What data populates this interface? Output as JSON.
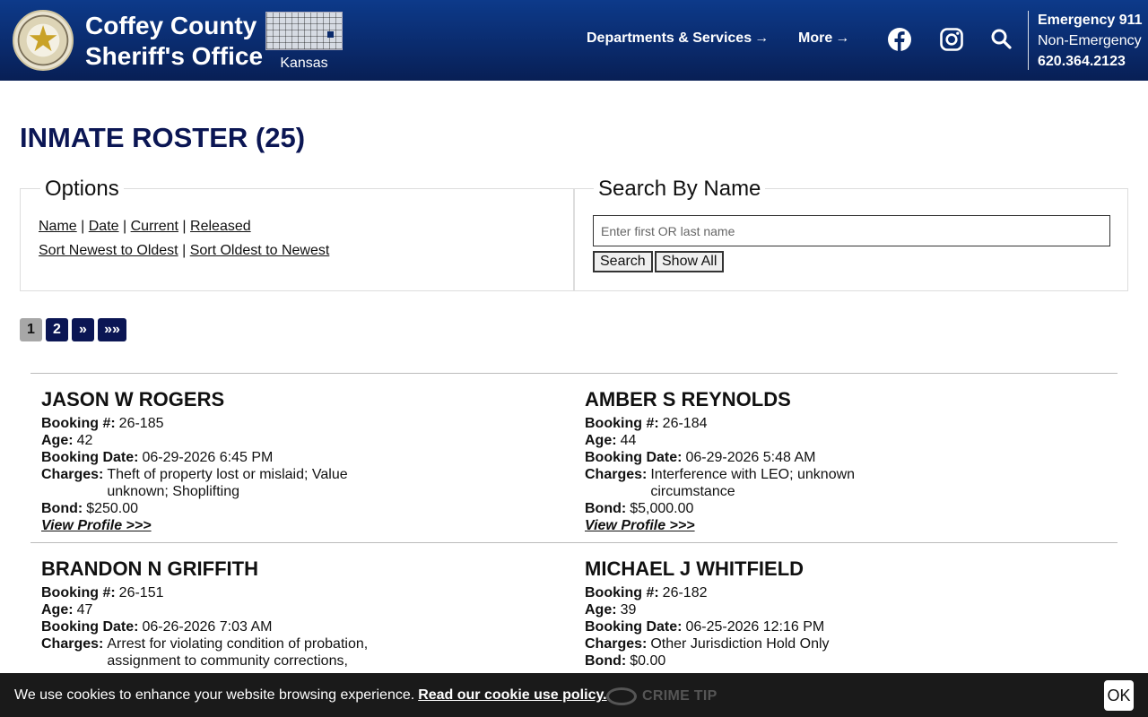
{
  "header": {
    "brand_line1": "Coffey County",
    "brand_line2": "Sheriff's Office",
    "state_label": "Kansas",
    "nav": [
      {
        "label": "Departments & Services"
      },
      {
        "label": "More"
      }
    ],
    "contact": {
      "emergency": "Emergency 911",
      "non_emergency_label": "Non-Emergency",
      "phone": "620.364.2123"
    }
  },
  "page": {
    "title": "INMATE ROSTER (25)"
  },
  "options": {
    "title": "Options",
    "filters": [
      "Name",
      "Date",
      "Current",
      "Released"
    ],
    "sort": [
      "Sort Newest to Oldest",
      "Sort Oldest to Newest"
    ],
    "separator": "|"
  },
  "search": {
    "title": "Search By Name",
    "placeholder": "Enter first OR last name",
    "search_button": "Search",
    "show_all_button": "Show All"
  },
  "pagination": {
    "pages": [
      "1",
      "2"
    ],
    "next": "»",
    "last": "»»",
    "current": "1"
  },
  "labels": {
    "booking": "Booking #:",
    "age": "Age:",
    "booking_date": "Booking Date:",
    "charges": "Charges:",
    "bond": "Bond:",
    "view_profile": "View Profile >>>"
  },
  "inmates": [
    {
      "name": "JASON W ROGERS",
      "booking": "26-185",
      "age": "42",
      "booking_date": "06-29-2026 6:45 PM",
      "charges": "Theft of property lost or mislaid; Value unknown; Shoplifting",
      "bond": "$250.00"
    },
    {
      "name": "AMBER S REYNOLDS",
      "booking": "26-184",
      "age": "44",
      "booking_date": "06-29-2026 5:48 AM",
      "charges": "Interference with LEO; unknown circumstance",
      "bond": "$5,000.00"
    },
    {
      "name": "BRANDON N GRIFFITH",
      "booking": "26-151",
      "age": "47",
      "booking_date": "06-26-2026 7:03 AM",
      "charges": "Arrest for violating condition of probation, assignment to community corrections,",
      "bond": ""
    },
    {
      "name": "MICHAEL J WHITFIELD",
      "booking": "26-182",
      "age": "39",
      "booking_date": "06-25-2026 12:16 PM",
      "charges": "Other Jurisdiction Hold Only",
      "bond": "$0.00"
    }
  ],
  "cookie": {
    "message": "We use cookies to enhance your website browsing experience.",
    "link": "Read our cookie use policy.",
    "ok": "OK",
    "crime_tip": "CRIME TIP"
  },
  "colors": {
    "header_blue": "#0a2a6b",
    "title_navy": "#0b1654",
    "pager_active": "#a7a7a7"
  }
}
